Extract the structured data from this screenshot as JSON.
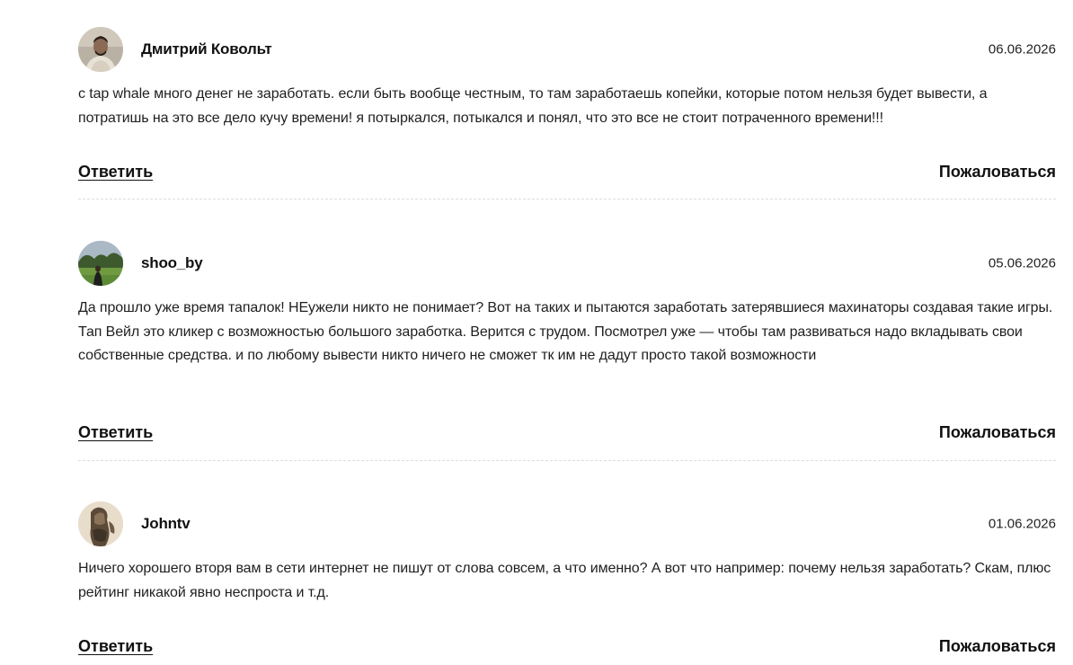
{
  "comments": [
    {
      "author": "Дмитрий Ковольт",
      "date": "06.06.2026",
      "text": "с tap whale много денег не заработать. если быть вообще честным, то там заработаешь копейки, которые потом нельзя будет вывести, а потратишь на это все дело кучу времени! я потыркался, потыкался и понял, что это все не стоит потраченного времени!!!",
      "reply_label": "Ответить",
      "report_label": "Пожаловаться",
      "avatar_icon": "man-portrait-avatar"
    },
    {
      "author": "shoo_by",
      "date": "05.06.2026",
      "text": "Да прошло уже время тапалок! НЕужели никто не понимает? Вот на таких и пытаются заработать затерявшиеся махинаторы создавая такие игры. Тап Вейл это кликер с возможностью большого заработка. Верится с трудом. Посмотрел уже — чтобы там развиваться надо вкладывать свои собственные средства. и по любому вывести никто ничего не сможет тк им не дадут просто такой возможности",
      "reply_label": "Ответить",
      "report_label": "Пожаловаться",
      "avatar_icon": "outdoor-park-avatar"
    },
    {
      "author": "Johntv",
      "date": "01.06.2026",
      "text": "Ничего хорошего вторя вам в сети интернет не пишут от слова совсем, а что именно? А вот что например: почему нельзя заработать? Скам, плюс рейтинг никакой явно неспроста и т.д.",
      "reply_label": "Ответить",
      "report_label": "Пожаловаться",
      "avatar_icon": "sculpture-avatar"
    }
  ]
}
